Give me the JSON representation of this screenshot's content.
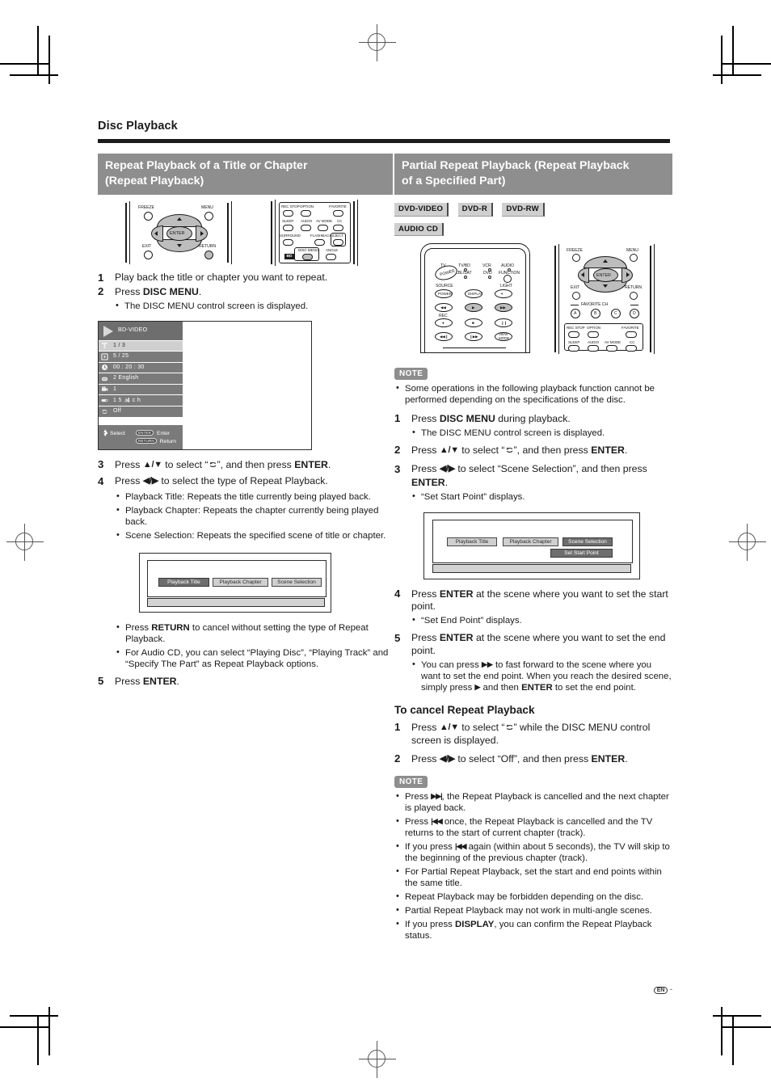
{
  "page": {
    "title": "Disc Playback",
    "footer_mark": "EN",
    "footer_dash": "-"
  },
  "left": {
    "heading_line1": "Repeat Playback of a Title or Chapter",
    "heading_line2": "(Repeat Playback)",
    "steps": [
      {
        "num": "1",
        "text": "Play back the title or chapter you want to repeat."
      },
      {
        "num": "2",
        "pre": "Press ",
        "bold": "DISC MENU",
        "post": ".",
        "sub": [
          "The DISC MENU control screen is displayed."
        ]
      }
    ],
    "step3": {
      "num": "3",
      "pre": "Press ",
      "arrows": "▲/▼",
      "mid": " to select “",
      "icon": "repeat-icon",
      "mid2": "”, and then press ",
      "bold": "ENTER",
      "post": "."
    },
    "step4": {
      "num": "4",
      "pre": "Press ",
      "arrows": "◀/▶",
      "post": " to select the type of Repeat Playback.",
      "bullets": [
        "Playback Title: Repeats the title currently being played back.",
        "Playback Chapter: Repeats the chapter currently being played back.",
        "Scene Selection: Repeats the specified scene of title or chapter."
      ]
    },
    "after_fig_bullets": [
      {
        "pre": "Press ",
        "bold": "RETURN",
        "post": " to cancel without setting the type of Repeat Playback."
      },
      {
        "pre": "For Audio CD, you can select “Playing Disc”, “Playing Track” and “Specify The Part” as Repeat Playback options.",
        "bold": "",
        "post": ""
      }
    ],
    "step5": {
      "num": "5",
      "pre": "Press ",
      "bold": "ENTER",
      "post": "."
    },
    "osd": {
      "header_label": "BD-VIDEO",
      "rows": [
        {
          "icon": "title-icon",
          "text": "1 / 3",
          "selected": true
        },
        {
          "icon": "chapter-icon",
          "text": "5 / 25",
          "selected": false
        },
        {
          "icon": "time-icon",
          "text": "00 : 20 : 30",
          "selected": false
        },
        {
          "icon": "subtitle-icon",
          "text": "2 English",
          "selected": false
        },
        {
          "icon": "angle-icon",
          "text": "1",
          "selected": false
        },
        {
          "icon": "audio-icon",
          "text": "1   5 . 1 c h",
          "selected": false
        },
        {
          "icon": "repeat-icon",
          "text": "Off",
          "selected": false
        }
      ],
      "footer_select": "Select",
      "footer_enter_key": "ENTER",
      "footer_enter": "Enter",
      "footer_return_key": "RETURN",
      "footer_return": "Return"
    },
    "selection_figure": {
      "chips": [
        {
          "label": "Playback Title",
          "selected": true
        },
        {
          "label": "Playback Chapter",
          "selected": false
        },
        {
          "label": "Scene Selection",
          "selected": false
        }
      ]
    },
    "remote_top": {
      "labels": [
        "FREEZE",
        "MENU",
        "EXIT",
        "RETURN",
        "ENTER"
      ],
      "labels2": [
        "REC STOP",
        "OPTION",
        "FAVORITE",
        "SLEEP",
        "AUDIO",
        "AV MODE",
        "CC",
        "SURROUND",
        "FLASHBACK",
        "EJECT",
        "DISC MENU",
        "ANGLE",
        "BD"
      ]
    }
  },
  "right": {
    "heading_line1": "Partial Repeat Playback (Repeat Playback",
    "heading_line2": "of a Specified Part)",
    "badges": [
      "DVD-VIDEO",
      "DVD-R",
      "DVD-RW",
      "AUDIO CD"
    ],
    "note_label": "NOTE",
    "note_bullets": [
      "Some operations in the following playback function cannot be performed depending on the specifications of the disc."
    ],
    "step1": {
      "num": "1",
      "pre": "Press ",
      "bold": "DISC MENU",
      "post": " during playback.",
      "sub": [
        "The DISC MENU control screen is displayed."
      ]
    },
    "step2": {
      "num": "2",
      "pre": "Press ",
      "arrows": "▲/▼",
      "mid": " to select “",
      "icon": "repeat-icon",
      "mid2": "”, and then press ",
      "bold": "ENTER",
      "post": "."
    },
    "step3": {
      "num": "3",
      "pre": "Press ",
      "arrows": "◀/▶",
      "mid": " to select “Scene Selection”, and then press ",
      "bold": "ENTER",
      "post": ".",
      "sub": [
        "“Set Start Point” displays."
      ]
    },
    "selection_figure": {
      "chips": [
        {
          "label": "Playback Title",
          "selected": false
        },
        {
          "label": "Playback Chapter",
          "selected": false
        },
        {
          "label": "Scene Selection",
          "selected": true
        }
      ],
      "sub_chip": {
        "label": "Set Start Point",
        "selected": true
      }
    },
    "step4": {
      "num": "4",
      "pre": "Press ",
      "bold": "ENTER",
      "post": " at the scene where you want to set the start point.",
      "sub": [
        "“Set End Point” displays."
      ]
    },
    "step5": {
      "num": "5",
      "pre": "Press ",
      "bold": "ENTER",
      "post": " at the scene where you want to set the end point.",
      "sub_pre": "You can press ",
      "sub_ff": "▶▶",
      "sub_mid": " to fast forward to the scene where you want to set the end point. When you reach the desired scene, simply press ",
      "sub_play": "▶",
      "sub_mid2": " and then ",
      "sub_bold": "ENTER",
      "sub_post": " to set the end point."
    },
    "cancel_heading": "To cancel Repeat Playback",
    "cancel1": {
      "num": "1",
      "pre": "Press ",
      "arrows": "▲/▼",
      "mid": " to select “",
      "icon": "repeat-icon",
      "mid2": "” while the DISC MENU control screen is displayed."
    },
    "cancel2": {
      "num": "2",
      "pre": "Press ",
      "arrows": "◀/▶",
      "mid": " to select “Off”, and then press ",
      "bold": "ENTER",
      "post": "."
    },
    "note2_label": "NOTE",
    "note2_bullets": [
      {
        "pre": "Press ",
        "glyph": "▶▶|",
        "post": ", the Repeat Playback is cancelled and the next chapter is played back."
      },
      {
        "pre": "Press ",
        "glyph": "|◀◀",
        "post": " once, the Repeat Playback is cancelled and the TV returns to the start of current chapter (track)."
      },
      {
        "pre": "If you press ",
        "glyph": "|◀◀",
        "post": " again (within about 5 seconds), the TV will skip to the beginning of the previous chapter (track)."
      },
      {
        "pre": "For Partial Repeat Playback, set the start and end points within the same title.",
        "glyph": "",
        "post": ""
      },
      {
        "pre": "Repeat Playback may be forbidden depending on the disc.",
        "glyph": "",
        "post": ""
      },
      {
        "pre": "Partial Repeat Playback may not work in multi-angle scenes.",
        "glyph": "",
        "post": ""
      },
      {
        "pre": "If you press ",
        "glyph": "",
        "bold": "DISPLAY",
        "post": ", you can confirm the Repeat Playback status."
      }
    ],
    "remote_left": {
      "top_labels": [
        "TV",
        "TV/BD",
        "VCR",
        "AUDIO",
        "CBL/SAT",
        "DVD",
        "FUNCTION",
        "SOURCE",
        "LIGHT",
        "REC"
      ],
      "button_labels": [
        "POWER",
        "DISPLAY",
        "VIEW MODE"
      ]
    },
    "remote_right": {
      "labels": [
        "FREEZE",
        "MENU",
        "EXIT",
        "RETURN",
        "ENTER",
        "FAVORITE CH",
        "A",
        "B",
        "C",
        "D",
        "REC STOP",
        "OPTION",
        "FAVORITE",
        "SLEEP",
        "AUDIO",
        "AV MODE",
        "CC"
      ]
    }
  },
  "colors": {
    "heading_bg": "#8e8e8e",
    "badge_bg": "#cfcfcf",
    "osd_row": "#7a7a7a",
    "osd_row_selected": "#cfcfcf",
    "text": "#1b1b1b"
  }
}
